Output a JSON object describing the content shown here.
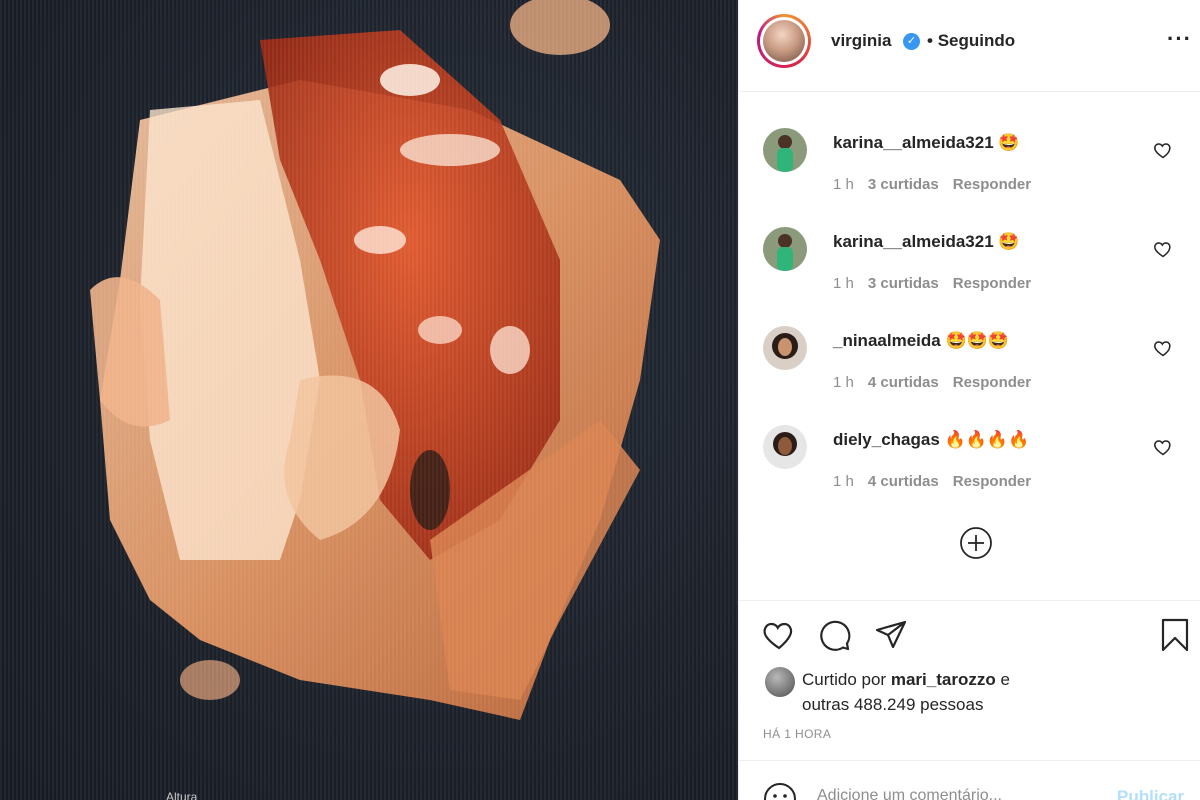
{
  "post": {
    "username": "virginia",
    "separator": "•",
    "follow_status": "Seguindo",
    "more_icon": "more-horizontal-icon",
    "media_caption": "Altura"
  },
  "comments": [
    {
      "user": "karina__almeida321",
      "emoji": "🤩",
      "time": "1 h",
      "likes": "3 curtidas",
      "reply": "Responder"
    },
    {
      "user": "karina__almeida321",
      "emoji": "🤩",
      "time": "1 h",
      "likes": "3 curtidas",
      "reply": "Responder"
    },
    {
      "user": "_ninaalmeida",
      "emoji": "🤩🤩🤩",
      "time": "1 h",
      "likes": "4 curtidas",
      "reply": "Responder"
    },
    {
      "user": "diely_chagas",
      "emoji": "🔥🔥🔥🔥",
      "time": "1 h",
      "likes": "4 curtidas",
      "reply": "Responder"
    }
  ],
  "likes": {
    "prefix": "Curtido por",
    "user": "mari_tarozzo",
    "conj": "e",
    "others": "outras 488.249 pessoas"
  },
  "posted_ago": "HÁ 1 HORA",
  "comment_box": {
    "placeholder": "Adicione um comentário...",
    "publish_label": "Publicar"
  },
  "colors": {
    "verified": "#3897f0",
    "publish_disabled": "#b2dffc",
    "meta_gray": "#8e8e8e"
  }
}
